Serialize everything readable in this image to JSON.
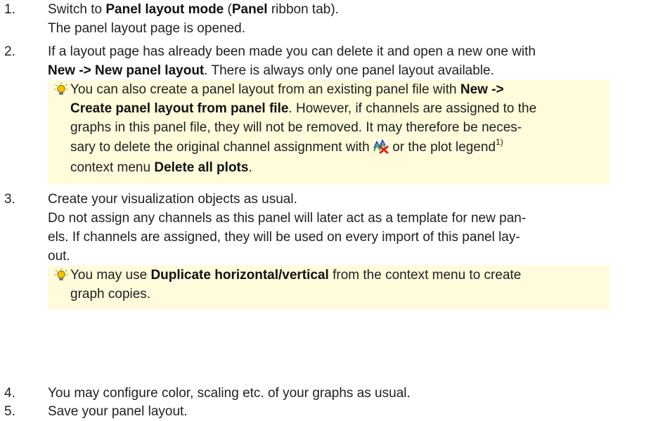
{
  "steps": [
    {
      "number": "1.",
      "p1": {
        "pre": "Switch to ",
        "b1": "Panel layout mode",
        "mid": " (",
        "b2": "Panel",
        "post": " ribbon tab)."
      },
      "p2": "The panel layout page is opened."
    },
    {
      "number": "2.",
      "line1": "If a layout page has already been made you can delete it and open a new one with",
      "line2": {
        "bold": "New -> New panel layout",
        "post": ". There is always only one panel layout available."
      },
      "tip": {
        "icon": "lightbulb-icon",
        "l1": {
          "pre": "You can also create a panel layout from an existing panel file with ",
          "bold": "New ->"
        },
        "l2": {
          "bold": "Create panel layout from panel file",
          "post": ". However, if channels are assigned to the"
        },
        "l3": "graphs in this panel file, they will not be removed. It may therefore be neces-",
        "l4": {
          "pre": "sary to delete the original channel assignment with ",
          "icon": "delete-plots-icon",
          "mid": " or the plot legend",
          "sup": "1)"
        },
        "l5": {
          "pre": "context menu ",
          "bold": "Delete all plots",
          "post": "."
        }
      }
    },
    {
      "number": "3.",
      "line1": "Create your visualization objects as usual.",
      "line2": "Do not assign any channels as this panel will later act as a template for new pan-",
      "line3": "els. If channels are assigned, they will be used on every import of this panel lay-",
      "line4": "out.",
      "tip": {
        "icon": "lightbulb-icon",
        "l1": {
          "pre": "You may use ",
          "bold": "Duplicate horizontal/vertical",
          "post": " from the context menu to create"
        },
        "l2": "graph copies."
      }
    },
    {
      "number": "4.",
      "line1": "You may configure color, scaling etc. of your graphs as usual."
    },
    {
      "number": "5.",
      "line1": "Save your panel layout."
    }
  ],
  "colors": {
    "tip_background": "#fffbdb",
    "text": "#1f1f1f",
    "bulb": "#f2c200"
  }
}
